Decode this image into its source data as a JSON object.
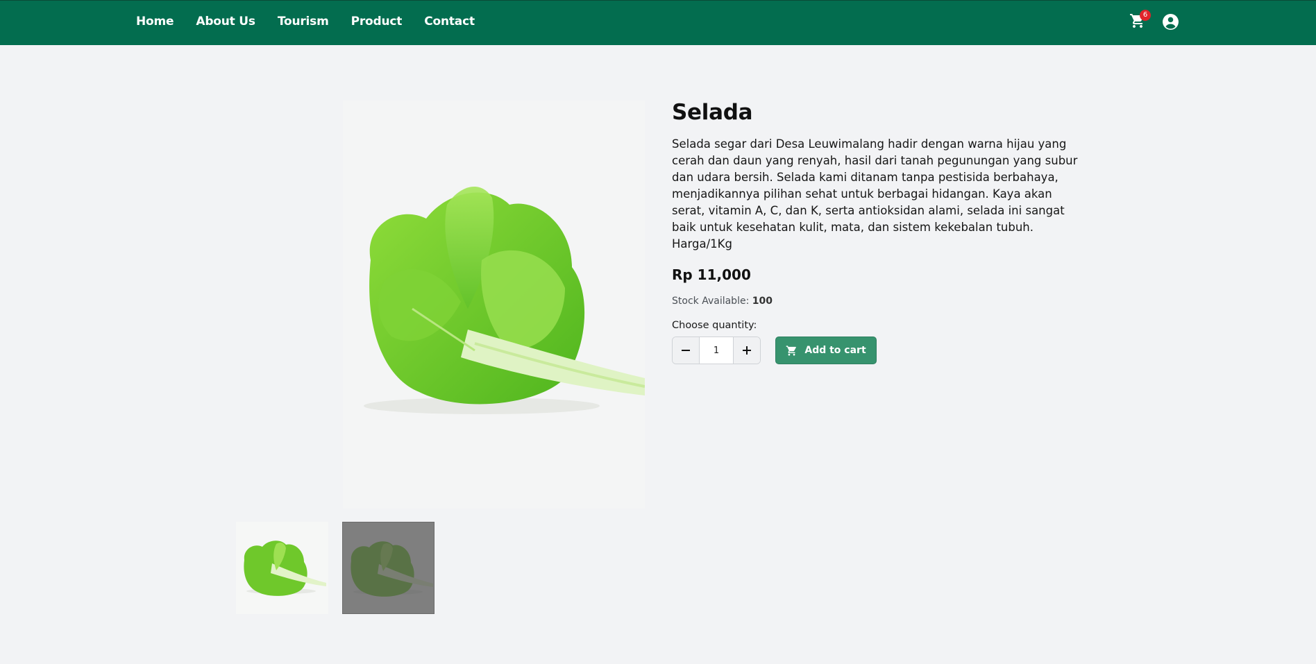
{
  "nav": {
    "items": [
      {
        "label": "Home"
      },
      {
        "label": "About Us"
      },
      {
        "label": "Tourism"
      },
      {
        "label": "Product"
      },
      {
        "label": "Contact"
      }
    ],
    "cart_count": "6",
    "cart_icon": "cart-icon",
    "user_icon": "user-circle-icon"
  },
  "product": {
    "name": "Selada",
    "description": "Selada segar dari Desa Leuwimalang hadir dengan warna hijau yang cerah dan daun yang renyah, hasil dari tanah pegunungan yang subur dan udara bersih. Selada kami ditanam tanpa pestisida berbahaya, menjadikannya pilihan sehat untuk berbagai hidangan. Kaya akan serat, vitamin A, C, dan K, serta antioksidan alami, selada ini sangat baik untuk kesehatan kulit, mata, dan sistem kekebalan tubuh. Harga/1Kg",
    "price": "Rp 11,000",
    "stock_label": "Stock Available:",
    "stock_value": "100",
    "quantity_label": "Choose quantity:",
    "quantity_value": "1",
    "add_to_cart_label": "Add to cart"
  },
  "colors": {
    "header": "#036d4f",
    "accent_button": "#37936e",
    "badge": "#e0242b",
    "background": "#f2f3f5"
  }
}
